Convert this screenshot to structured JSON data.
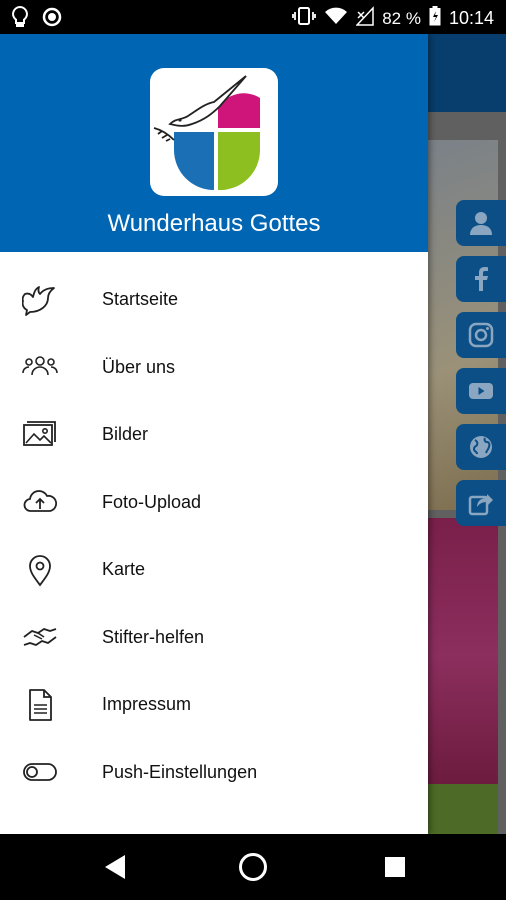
{
  "status_bar": {
    "battery": "82 %",
    "time": "10:14"
  },
  "drawer": {
    "title": "Wunderhaus Gottes",
    "items": [
      {
        "label": "Startseite",
        "icon": "dove-icon"
      },
      {
        "label": "Über uns",
        "icon": "group-icon"
      },
      {
        "label": "Bilder",
        "icon": "images-icon"
      },
      {
        "label": "Foto-Upload",
        "icon": "cloud-upload-icon"
      },
      {
        "label": "Karte",
        "icon": "map-pin-icon"
      },
      {
        "label": "Stifter-helfen",
        "icon": "handshake-icon"
      },
      {
        "label": "Impressum",
        "icon": "document-icon"
      },
      {
        "label": "Push-Einstellungen",
        "icon": "toggle-icon"
      }
    ]
  },
  "colors": {
    "header_blue": "#0066b3",
    "social_blue": "#0b4f86",
    "logo_magenta": "#d0157a",
    "logo_green": "#8cbf1f",
    "logo_blue": "#1a6fb5"
  }
}
